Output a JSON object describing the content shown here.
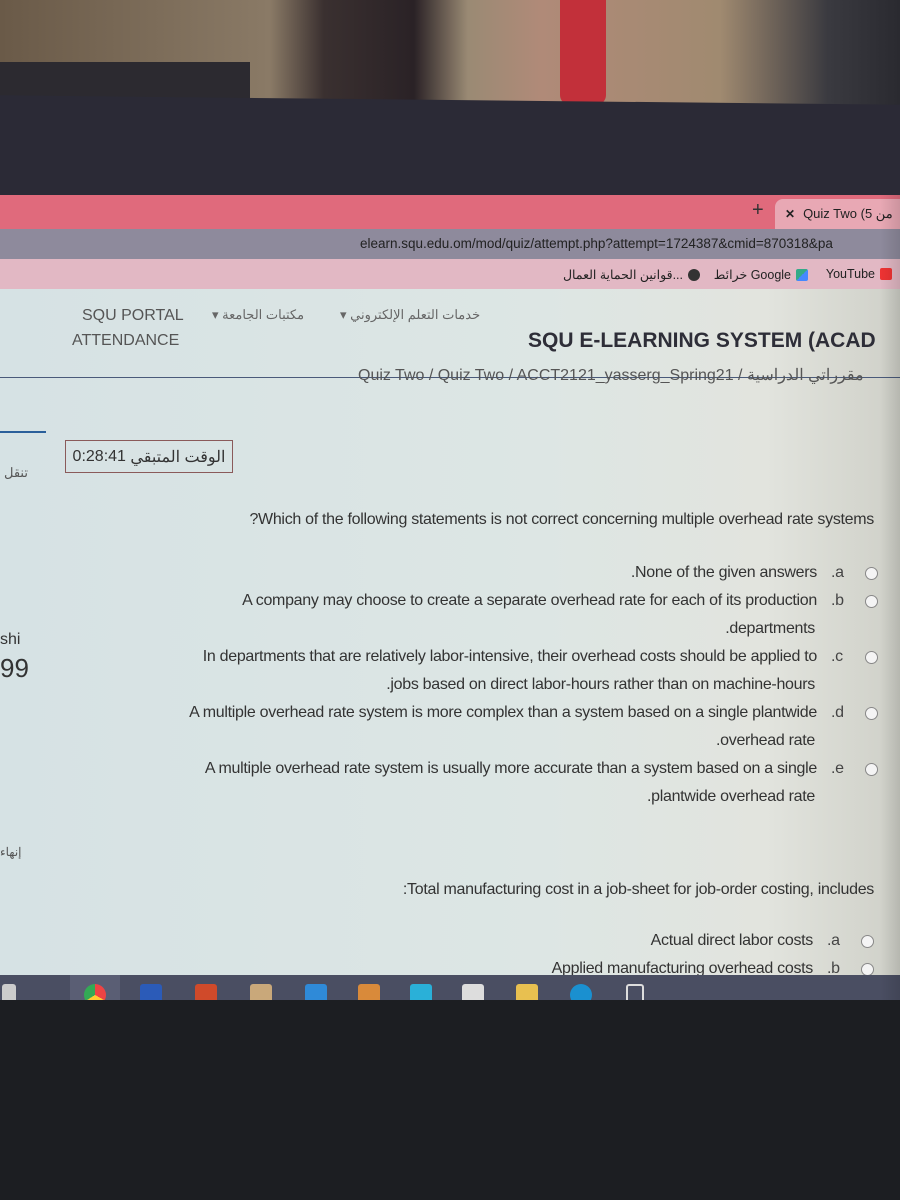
{
  "browser": {
    "tab_title": "Quiz Two (5 من",
    "tab_close": "✕",
    "new_tab": "+",
    "url": "elearn.squ.edu.om/mod/quiz/attempt.php?attempt=1724387&cmid=870318&pa",
    "bookmarks": [
      {
        "label": "YouTube",
        "icon": "youtube-icon"
      },
      {
        "label": "خرائط Google",
        "icon": "maps-icon"
      },
      {
        "label": "قوانين الحماية العمال...",
        "icon": "globe-icon"
      }
    ]
  },
  "site": {
    "nav_items": [
      "SQU PORTAL",
      "مكتبات الجامعة",
      "خدمات التعلم الإلكتروني"
    ],
    "nav_attendance": "ATTENDANCE",
    "title": "SQU E-LEARNING SYSTEM (ACAD",
    "breadcrumb": "Quiz Two / Quiz Two / ACCT2121_yasserg_Spring21 / مقرراتي الدراسية",
    "sidebar_nav": "تنقل",
    "sidebar_user": "shi",
    "sidebar_num": "99",
    "sidebar_finish": "إنهاء"
  },
  "timer": {
    "label": "الوقت المتبقي",
    "value": "0:28:41"
  },
  "questions": [
    {
      "text": "?Which of the following statements is not correct concerning multiple overhead rate systems",
      "options": [
        {
          "letter": ".a",
          "lines": [
            ".None of the given answers"
          ]
        },
        {
          "letter": ".b",
          "lines": [
            "A company may choose to create a separate overhead rate for each of its production",
            ".departments"
          ]
        },
        {
          "letter": ".c",
          "lines": [
            "In departments that are relatively labor-intensive, their overhead costs should be applied to",
            ".jobs based on direct labor-hours rather than on machine-hours"
          ]
        },
        {
          "letter": ".d",
          "lines": [
            "A multiple overhead rate system is more complex than a system based on a single plantwide",
            ".overhead rate"
          ]
        },
        {
          "letter": ".e",
          "lines": [
            "A multiple overhead rate system is usually more accurate than a system based on a single",
            ".plantwide overhead rate"
          ]
        }
      ]
    },
    {
      "text": ":Total manufacturing cost in a job-sheet for job-order costing, includes",
      "options": [
        {
          "letter": ".a",
          "lines": [
            "Actual direct labor costs"
          ]
        },
        {
          "letter": ".b",
          "lines": [
            "Applied manufacturing overhead costs"
          ]
        }
      ]
    }
  ],
  "taskbar": {
    "apps": [
      "chrome-icon",
      "word-icon",
      "powerpoint-icon",
      "app-m-icon",
      "mail-icon",
      "photo-app-icon",
      "l-app-icon",
      "store-icon",
      "file-explorer-icon",
      "edge-icon",
      "task-view-icon"
    ]
  }
}
